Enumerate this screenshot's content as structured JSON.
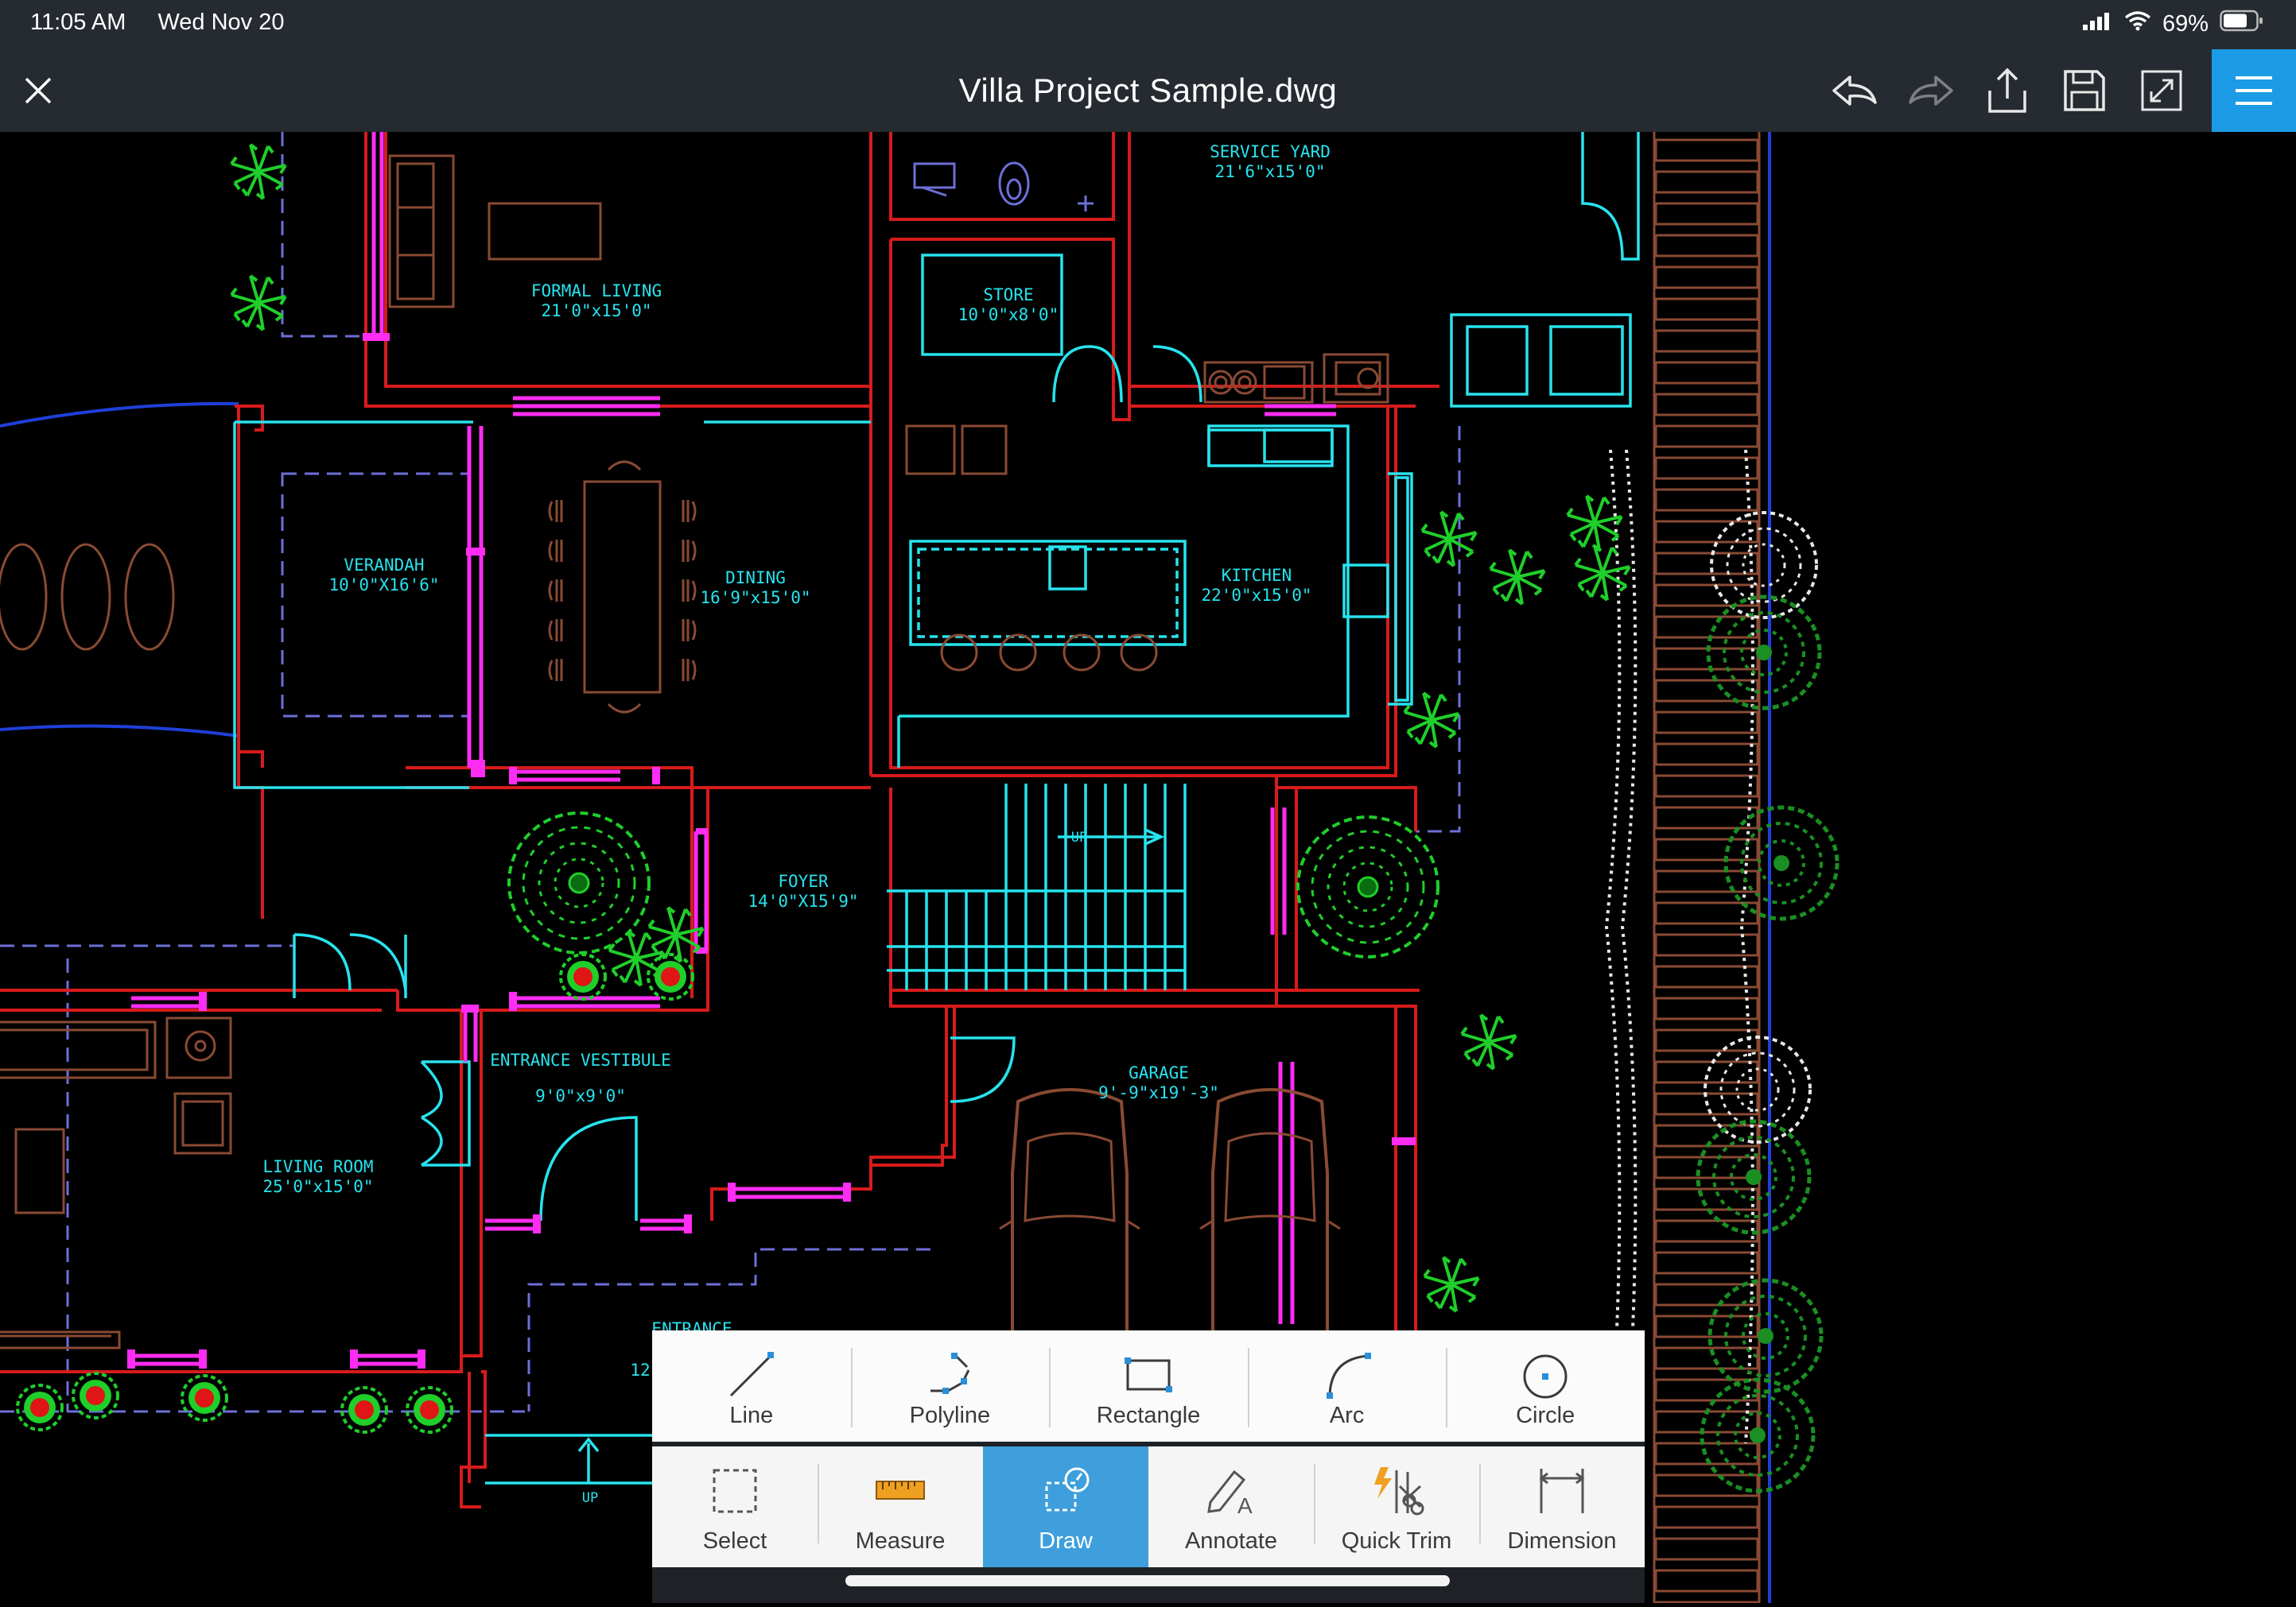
{
  "status_bar": {
    "time": "11:05 AM",
    "date": "Wed Nov 20",
    "battery": "69%"
  },
  "title_bar": {
    "document_title": "Villa Project Sample.dwg"
  },
  "drawing": {
    "rooms": [
      {
        "name": "FORMAL LIVING",
        "size": "21'0\"x15'0\""
      },
      {
        "name": "SERVICE YARD",
        "size": "21'6\"x15'0\""
      },
      {
        "name": "STORE",
        "size": "10'0\"x8'0\""
      },
      {
        "name": "VERANDAH",
        "size": "10'0\"X16'6\""
      },
      {
        "name": "DINING",
        "size": "16'9\"x15'0\""
      },
      {
        "name": "KITCHEN",
        "size": "22'0\"x15'0\""
      },
      {
        "name": "FOYER",
        "size": "14'0\"X15'9\""
      },
      {
        "name": "ENTRANCE VESTIBULE",
        "size": "9'0\"x9'0\""
      },
      {
        "name": "GARAGE",
        "size": "9'-9\"x19'-3\""
      },
      {
        "name": "LIVING ROOM",
        "size": "25'0\"x15'0\""
      }
    ],
    "misc_labels": {
      "up_1": "UP",
      "up_2": "UP",
      "entrance_partial": "ENTRANCE",
      "partial_12": "12"
    }
  },
  "draw_tools": [
    {
      "label": "Line",
      "icon": "line-icon"
    },
    {
      "label": "Polyline",
      "icon": "polyline-icon"
    },
    {
      "label": "Rectangle",
      "icon": "rectangle-icon"
    },
    {
      "label": "Arc",
      "icon": "arc-icon"
    },
    {
      "label": "Circle",
      "icon": "circle-icon"
    }
  ],
  "main_tools": [
    {
      "label": "Select",
      "icon": "select-icon",
      "active": false
    },
    {
      "label": "Measure",
      "icon": "ruler-icon",
      "active": false
    },
    {
      "label": "Draw",
      "icon": "draw-icon",
      "active": true
    },
    {
      "label": "Annotate",
      "icon": "annotate-icon",
      "active": false
    },
    {
      "label": "Quick Trim",
      "icon": "quick-trim-icon",
      "active": false
    },
    {
      "label": "Dimension",
      "icon": "dimension-icon",
      "active": false
    }
  ],
  "colors": {
    "walls": "#d81b1b",
    "fixtures": "#27e3ee",
    "windows": "#ff2cf3",
    "furniture": "#8a4a34",
    "plants": "#1fcf2a",
    "accent_blue": "#1c9be6",
    "bar_bg": "#262a31"
  }
}
